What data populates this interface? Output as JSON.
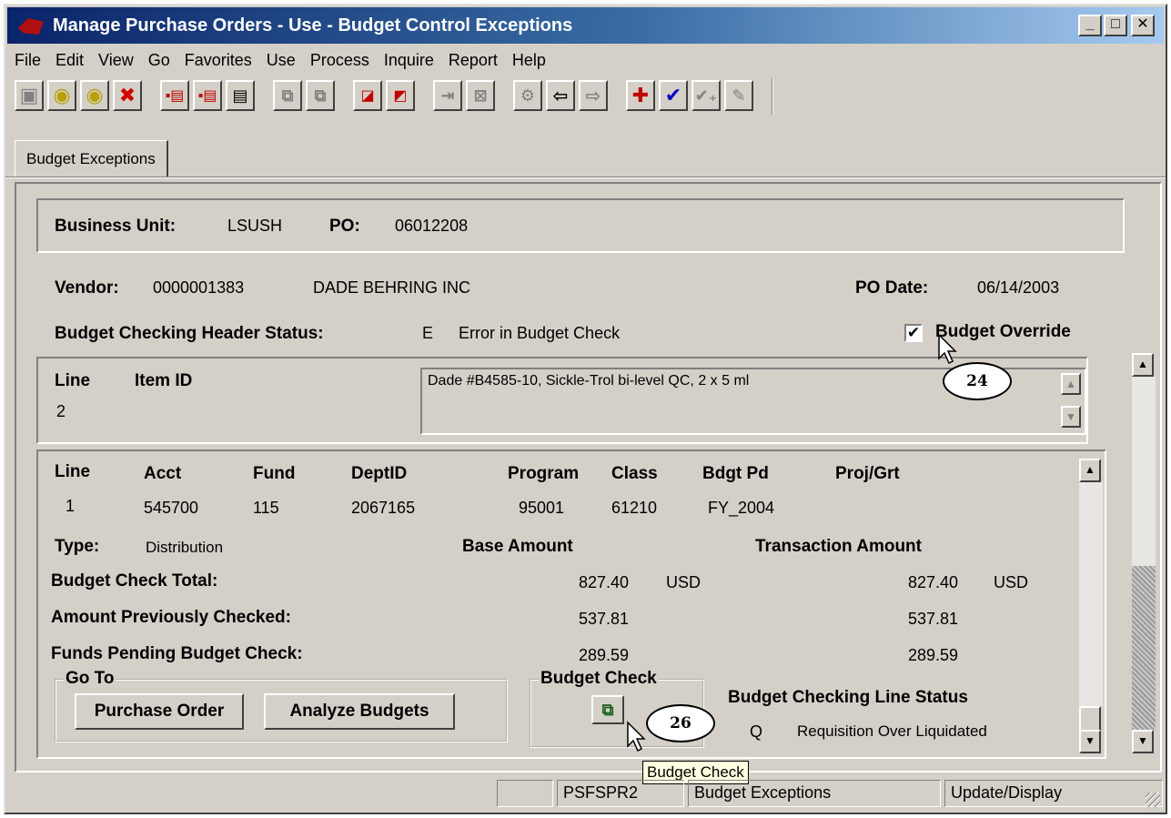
{
  "window": {
    "title": "Manage Purchase Orders - Use - Budget Control Exceptions",
    "minimize": "_",
    "maximize": "□",
    "close": "✕"
  },
  "menu": [
    "File",
    "Edit",
    "View",
    "Go",
    "Favorites",
    "Use",
    "Process",
    "Inquire",
    "Report",
    "Help"
  ],
  "tab": "Budget Exceptions",
  "header": {
    "business_unit_label": "Business Unit:",
    "business_unit": "LSUSH",
    "po_label": "PO:",
    "po": "06012208",
    "vendor_label": "Vendor:",
    "vendor_id": "0000001383",
    "vendor_name": "DADE BEHRING INC",
    "po_date_label": "PO Date:",
    "po_date": "06/14/2003",
    "status_label": "Budget Checking Header Status:",
    "status_code": "E",
    "status_text": "Error in Budget Check",
    "override_label": "Budget Override",
    "override_checked": "✔"
  },
  "line": {
    "line_label": "Line",
    "item_label": "Item ID",
    "line_value": "2",
    "description": "Dade #B4585-10, Sickle-Trol bi-level QC, 2 x 5 ml"
  },
  "dist": {
    "headers": [
      "Line",
      "Acct",
      "Fund",
      "DeptID",
      "Program",
      "Class",
      "Bdgt Pd",
      "Proj/Grt"
    ],
    "values": [
      "1",
      "545700",
      "115",
      "2067165",
      "95001",
      "61210",
      "FY_2004",
      ""
    ],
    "type_label": "Type:",
    "type_value": "Distribution",
    "base_amount_label": "Base Amount",
    "trans_amount_label": "Transaction Amount",
    "rows": [
      {
        "label": "Budget Check Total:",
        "base": "827.40",
        "base_cur": "USD",
        "trans": "827.40",
        "trans_cur": "USD"
      },
      {
        "label": "Amount Previously Checked:",
        "base": "537.81",
        "base_cur": "",
        "trans": "537.81",
        "trans_cur": ""
      },
      {
        "label": "Funds Pending Budget Check:",
        "base": "289.59",
        "base_cur": "",
        "trans": "289.59",
        "trans_cur": ""
      }
    ],
    "goto_legend": "Go To",
    "purchase_order_button": "Purchase Order",
    "analyze_button": "Analyze Budgets",
    "budget_check_legend": "Budget Check",
    "line_status_label": "Budget Checking Line Status",
    "line_status_code": "Q",
    "line_status_text": "Requisition Over Liquidated"
  },
  "callouts": {
    "first": "24",
    "second": "26"
  },
  "tooltip": "Budget Check",
  "statusbar": [
    "PSFSPR2",
    "Budget Exceptions",
    "Update/Display"
  ],
  "colors": {
    "titlebar": "#0a246a",
    "face": "#d4d0c8",
    "tooltip": "#ffffe1"
  },
  "icons": [
    "save-icon",
    "traffic-light-icon",
    "traffic-light-alert-icon",
    "delete-icon",
    "insert-row-icon",
    "check-icon",
    "pencil-icon"
  ]
}
